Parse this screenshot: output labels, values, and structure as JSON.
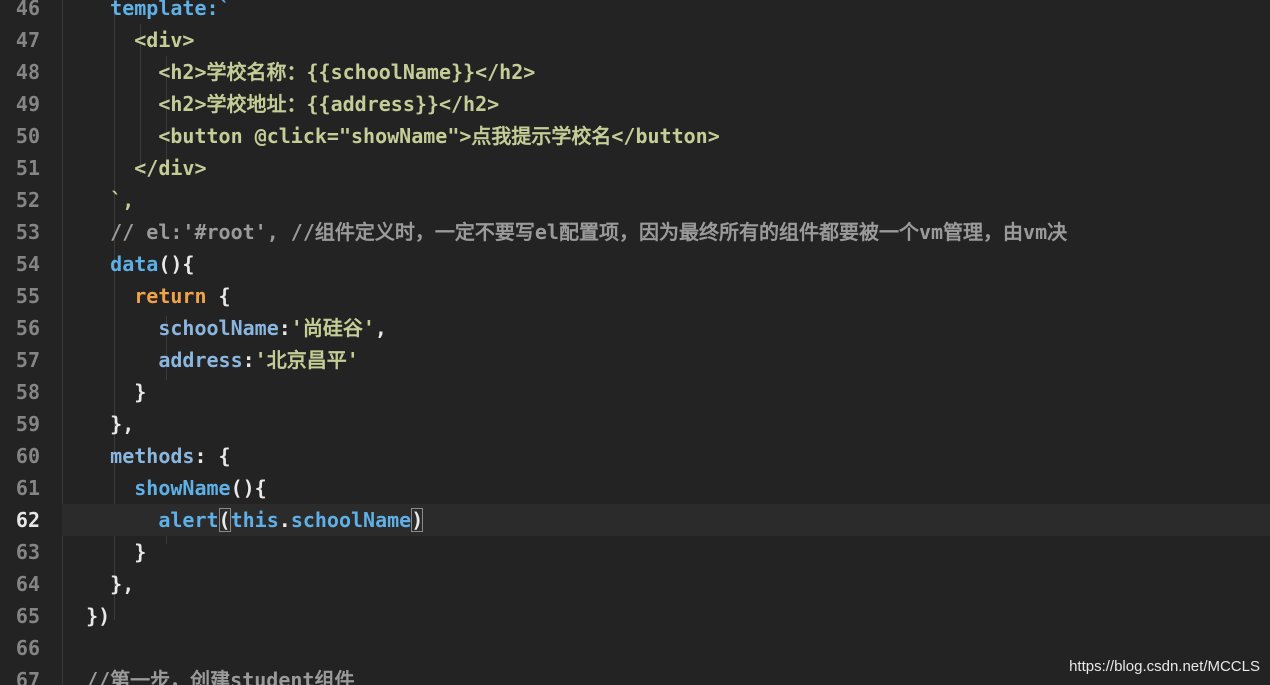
{
  "editor": {
    "lines": [
      {
        "no": "46",
        "tokens": [
          {
            "t": "    template:`",
            "c": "tok-id"
          }
        ]
      },
      {
        "no": "47",
        "tokens": [
          {
            "t": "      <div>",
            "c": "tok-tag"
          }
        ]
      },
      {
        "no": "48",
        "tokens": [
          {
            "t": "        <h2>学校名称：{{schoolName}}</h2>",
            "c": "tok-tag"
          }
        ]
      },
      {
        "no": "49",
        "tokens": [
          {
            "t": "        <h2>学校地址：{{address}}</h2>",
            "c": "tok-tag"
          }
        ]
      },
      {
        "no": "50",
        "tokens": [
          {
            "t": "        <button @click=\"showName\">点我提示学校名</button>",
            "c": "tok-tag"
          }
        ]
      },
      {
        "no": "51",
        "tokens": [
          {
            "t": "      </div>",
            "c": "tok-tag"
          }
        ]
      },
      {
        "no": "52",
        "tokens": [
          {
            "t": "    `,",
            "c": "tok-tag"
          }
        ]
      },
      {
        "no": "53",
        "tokens": [
          {
            "t": "    // el:'#root', //组件定义时，一定不要写el配置项，因为最终所有的组件都要被一个vm管理，由vm决",
            "c": "tok-cmt"
          }
        ]
      },
      {
        "no": "54",
        "tokens": [
          {
            "t": "    ",
            "c": "tok-punc"
          },
          {
            "t": "data",
            "c": "tok-id"
          },
          {
            "t": "(){",
            "c": "tok-punc"
          }
        ]
      },
      {
        "no": "55",
        "tokens": [
          {
            "t": "      ",
            "c": "tok-punc"
          },
          {
            "t": "return",
            "c": "tok-ret"
          },
          {
            "t": " {",
            "c": "tok-punc"
          }
        ]
      },
      {
        "no": "56",
        "tokens": [
          {
            "t": "        ",
            "c": "tok-punc"
          },
          {
            "t": "schoolName",
            "c": "tok-prop"
          },
          {
            "t": ":",
            "c": "tok-punc"
          },
          {
            "t": "'尚硅谷'",
            "c": "tok-str"
          },
          {
            "t": ",",
            "c": "tok-punc"
          }
        ]
      },
      {
        "no": "57",
        "tokens": [
          {
            "t": "        ",
            "c": "tok-punc"
          },
          {
            "t": "address",
            "c": "tok-prop"
          },
          {
            "t": ":",
            "c": "tok-punc"
          },
          {
            "t": "'北京昌平'",
            "c": "tok-str"
          }
        ]
      },
      {
        "no": "58",
        "tokens": [
          {
            "t": "      }",
            "c": "tok-punc"
          }
        ]
      },
      {
        "no": "59",
        "tokens": [
          {
            "t": "    },",
            "c": "tok-punc"
          }
        ]
      },
      {
        "no": "60",
        "tokens": [
          {
            "t": "    ",
            "c": "tok-punc"
          },
          {
            "t": "methods",
            "c": "tok-prop"
          },
          {
            "t": ": {",
            "c": "tok-punc"
          }
        ]
      },
      {
        "no": "61",
        "tokens": [
          {
            "t": "      ",
            "c": "tok-punc"
          },
          {
            "t": "showName",
            "c": "tok-id"
          },
          {
            "t": "(){",
            "c": "tok-punc"
          }
        ]
      },
      {
        "no": "62",
        "active": true,
        "tokens": [
          {
            "t": "        ",
            "c": "tok-punc"
          },
          {
            "t": "alert",
            "c": "tok-id"
          },
          {
            "t": "(",
            "c": "tok-punc bracket"
          },
          {
            "t": "this",
            "c": "tok-this"
          },
          {
            "t": ".",
            "c": "tok-punc"
          },
          {
            "t": "schoolName",
            "c": "tok-id"
          },
          {
            "t": ")",
            "c": "tok-punc bracket"
          }
        ]
      },
      {
        "no": "63",
        "tokens": [
          {
            "t": "      }",
            "c": "tok-punc"
          }
        ]
      },
      {
        "no": "64",
        "tokens": [
          {
            "t": "    },",
            "c": "tok-punc"
          }
        ]
      },
      {
        "no": "65",
        "tokens": [
          {
            "t": "  })",
            "c": "tok-punc"
          }
        ]
      },
      {
        "no": "66",
        "tokens": [
          {
            "t": "",
            "c": "tok-punc"
          }
        ]
      },
      {
        "no": "67",
        "tokens": [
          {
            "t": "  //第一步，创建student组件",
            "c": "tok-cmt"
          }
        ]
      }
    ]
  },
  "watermark": "https://blog.csdn.net/MCCLS"
}
